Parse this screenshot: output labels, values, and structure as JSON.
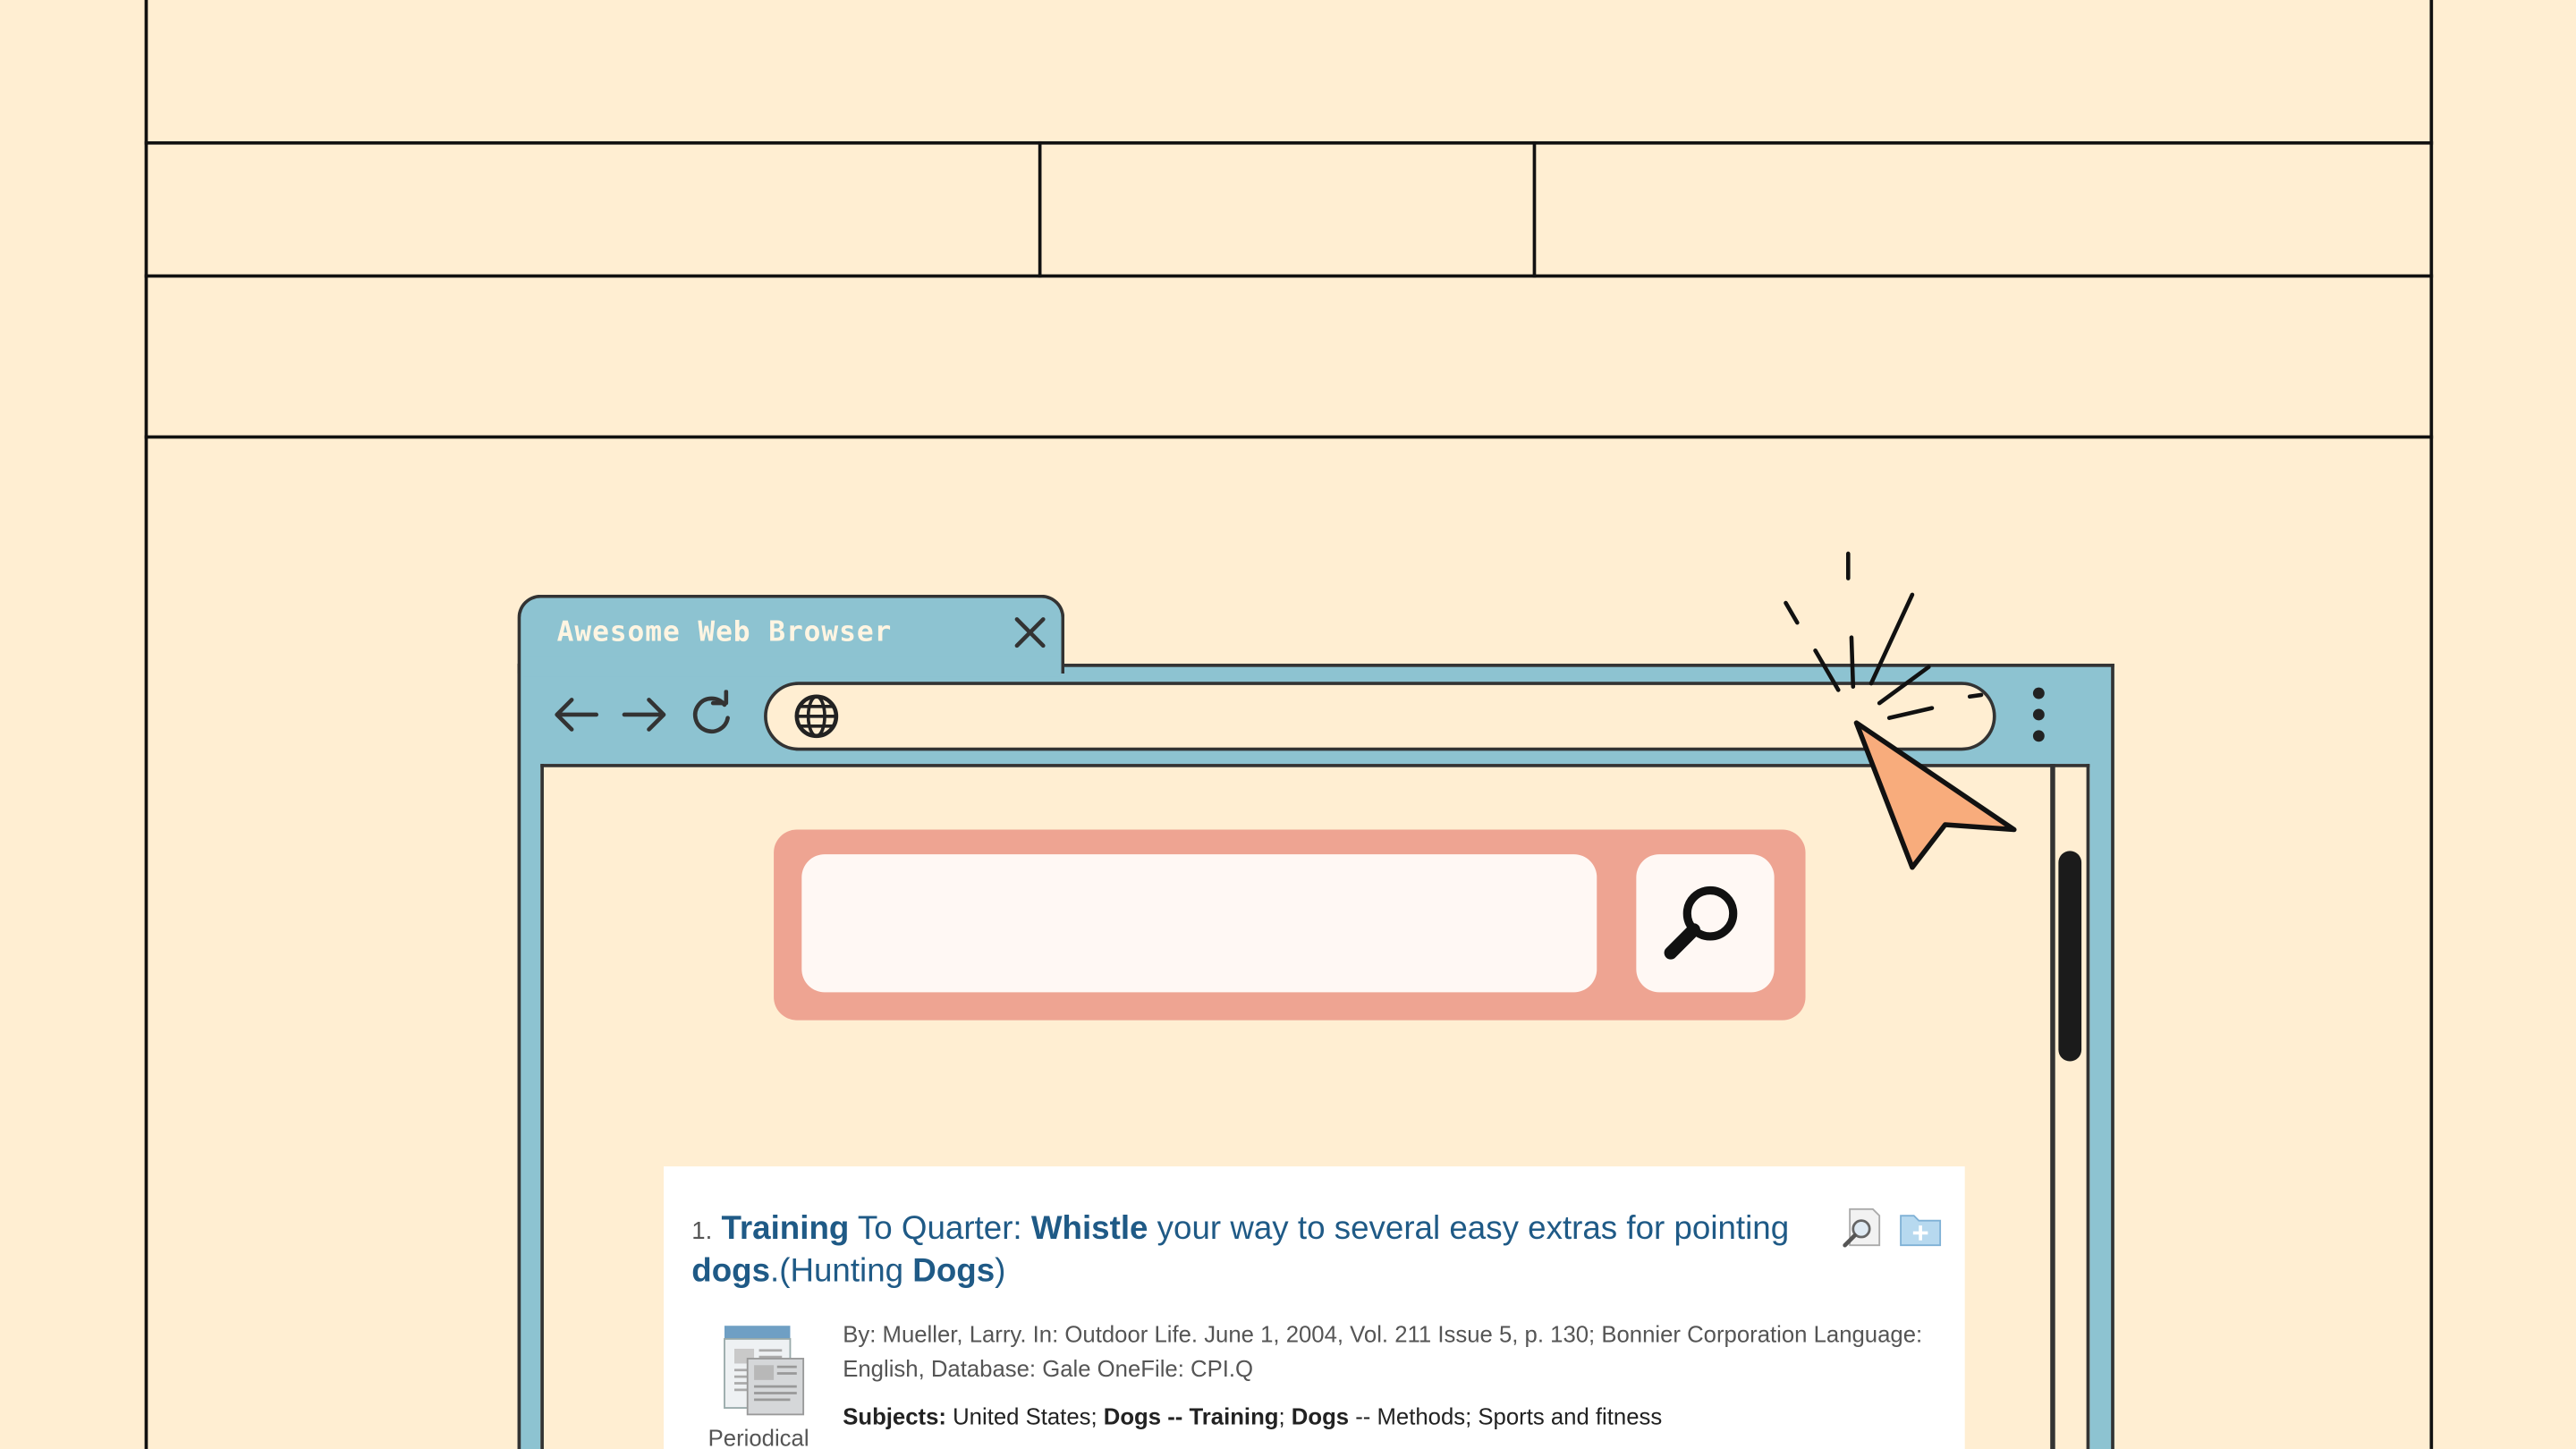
{
  "browser": {
    "tab_title": "Awesome Web Browser",
    "tab_close_icon": "close-icon",
    "back_icon": "arrow-left-icon",
    "forward_icon": "arrow-right-icon",
    "reload_icon": "reload-icon",
    "url_icon": "globe-icon",
    "url_value": "",
    "menu_icon": "kebab-menu-icon"
  },
  "search": {
    "value": "",
    "button_icon": "magnifier-icon"
  },
  "result": {
    "number": "1.",
    "title_parts": {
      "p1": "Training",
      "p2": " To Quarter: ",
      "p3": "Whistle",
      "p4": " your way to several easy extras for pointing ",
      "p5": "dogs",
      "p6": ".(Hunting ",
      "p7": "Dogs",
      "p8": ")"
    },
    "meta": "By: Mueller, Larry. In: Outdoor Life. June 1, 2004, Vol. 211 Issue 5, p. 130; Bonnier Corporation Language: English, Database: Gale OneFile: CPI.Q",
    "subjects_label": "Subjects:",
    "subjects_parts": {
      "s1": " United States; ",
      "s2": "Dogs -- Training",
      "s3": "; ",
      "s4": "Dogs",
      "s5": " -- Methods; Sports and fitness"
    },
    "type_label": "Periodical",
    "preview_icon": "magnifier-preview-icon",
    "folder_icon": "add-to-folder-icon"
  },
  "colors": {
    "background": "#ffeed2",
    "browser_blue": "#8dc3d1",
    "search_pink": "#eea492",
    "cursor_orange": "#f8ac7c",
    "link_blue": "#1f5a86"
  }
}
